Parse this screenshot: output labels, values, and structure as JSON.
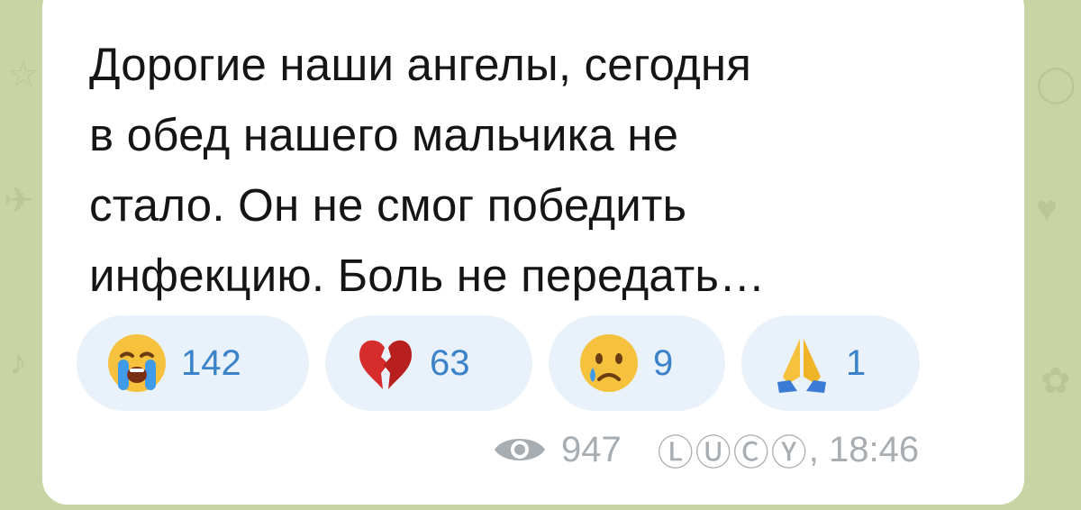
{
  "message": {
    "lines": [
      "Дорогие наши ангелы, сегодня",
      "в обед нашего мальчика не",
      "стало. Он не смог победить",
      "инфекцию. Боль не передать…"
    ]
  },
  "reactions": [
    {
      "icon": "loudly-crying-face-icon",
      "count": "142"
    },
    {
      "icon": "broken-heart-icon",
      "count": "63"
    },
    {
      "icon": "crying-face-icon",
      "count": "9"
    },
    {
      "icon": "folded-hands-icon",
      "count": "1"
    }
  ],
  "footer": {
    "icon": "eye-icon",
    "views": "947",
    "signature": "ⓁⓊⒸⓎ",
    "time": ", 18:46"
  },
  "colors": {
    "background": "#c8d4a4",
    "bubble": "#ffffff",
    "reaction_bg": "#e9f1fa",
    "reaction_count": "#3a82c9",
    "meta": "#a8adb2"
  }
}
